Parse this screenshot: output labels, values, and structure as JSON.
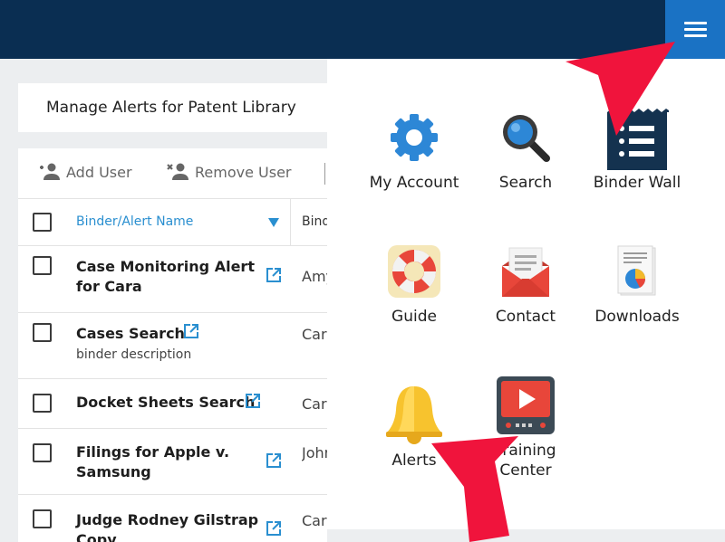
{
  "page": {
    "title": "Manage Alerts for Patent Library"
  },
  "toolbar": {
    "add_user": "Add User",
    "remove_user": "Remove User"
  },
  "table": {
    "header_name": "Binder/Alert Name",
    "header_binder": "Binder",
    "rows": [
      {
        "name_line1": "Case Monitoring Alert",
        "name_line2": "for Cara",
        "desc": "",
        "binder": "Amy"
      },
      {
        "name_line1": "Cases Search",
        "name_line2": "",
        "desc": "binder description",
        "binder": "Cara"
      },
      {
        "name_line1": "Docket Sheets Search",
        "name_line2": "",
        "desc": "",
        "binder": "Cara"
      },
      {
        "name_line1": "Filings for Apple v.",
        "name_line2": "Samsung",
        "desc": "",
        "binder": "John"
      },
      {
        "name_line1": "Judge Rodney Gilstrap",
        "name_line2": "Copy",
        "desc": "",
        "binder": "Cara"
      }
    ]
  },
  "menu": {
    "items": [
      {
        "label": "My Account",
        "icon": "gear-icon"
      },
      {
        "label": "Search",
        "icon": "magnifier-icon"
      },
      {
        "label": "Binder Wall",
        "icon": "binder-wall-icon"
      },
      {
        "label": "Guide",
        "icon": "lifebuoy-icon"
      },
      {
        "label": "Contact",
        "icon": "envelope-icon"
      },
      {
        "label": "Downloads",
        "icon": "document-chart-icon"
      },
      {
        "label": "Alerts",
        "icon": "bell-icon"
      },
      {
        "label": "Training",
        "label2": "Center",
        "icon": "video-player-icon"
      }
    ]
  },
  "colors": {
    "header_bg": "#0a2e52",
    "hamburger_bg": "#1a72c4",
    "link_blue": "#2a8fd0",
    "annotation_red": "#f0143c"
  }
}
